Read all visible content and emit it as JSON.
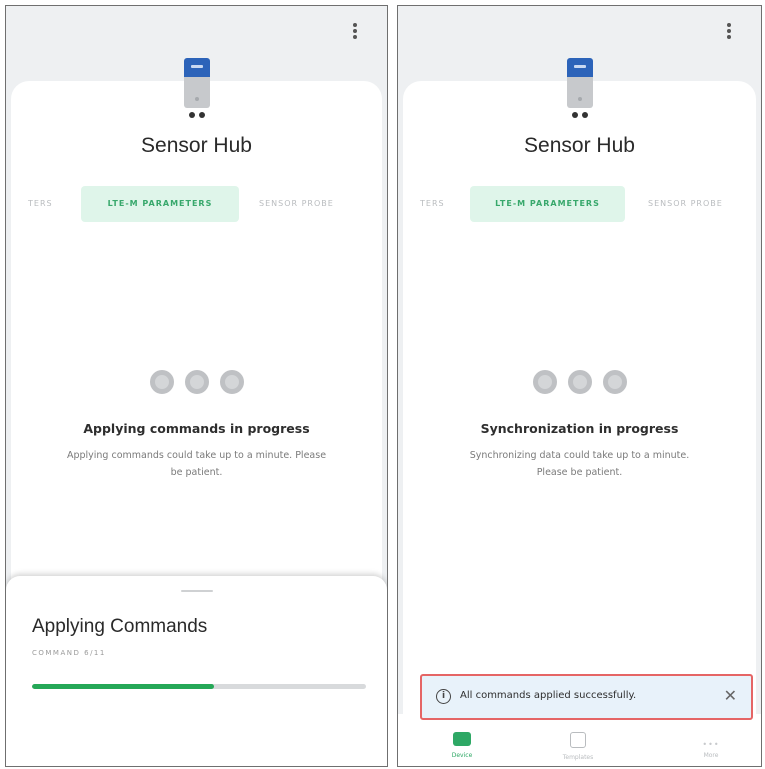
{
  "screens": [
    {
      "title": "Sensor Hub",
      "device_label": "M-BUS",
      "tabs": [
        "TERS",
        "LTE-M PARAMETERS",
        "SENSOR PROBE"
      ],
      "active_tab": "LTE-M PARAMETERS",
      "status_title": "Applying commands in progress",
      "status_desc": "Applying commands could take up to a minute. Please be patient.",
      "sheet": {
        "title": "Applying Commands",
        "subtitle": "COMMAND 6/11",
        "progress_fraction": 0.545
      }
    },
    {
      "title": "Sensor Hub",
      "device_label": "M-BUS",
      "tabs": [
        "TERS",
        "LTE-M PARAMETERS",
        "SENSOR PROBE"
      ],
      "active_tab": "LTE-M PARAMETERS",
      "status_title": "Synchronization in progress",
      "status_desc": "Synchronizing data could take up to a minute. Please be patient.",
      "snackbar": {
        "icon": "info-icon",
        "message": "All commands applied successfully.",
        "close_icon": "close-icon"
      },
      "nav": [
        {
          "icon": "device-icon",
          "label": "Device"
        },
        {
          "icon": "templates-icon",
          "label": "Templates"
        },
        {
          "icon": "more-icon",
          "label": "More"
        }
      ]
    }
  ],
  "colors": {
    "accent_green": "#2ea865",
    "active_tab_bg": "#dff5ea",
    "device_blue": "#2c63b9",
    "snackbar_bg": "#e8f2fa",
    "highlight_red": "#e56565"
  }
}
